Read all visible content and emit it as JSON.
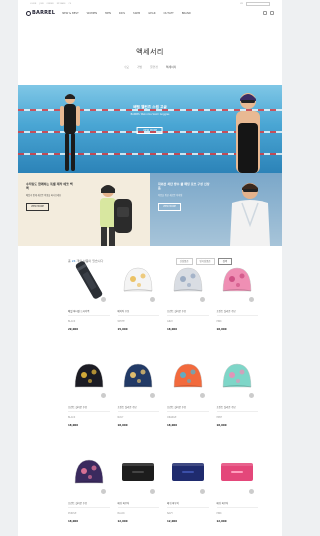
{
  "brand": {
    "logo_text": "BARREL"
  },
  "topbar": {
    "links": [
      "LOGIN",
      "JOIN",
      "ORDER",
      "MY PAGE",
      "CS"
    ],
    "right": "KR"
  },
  "gnb": [
    "NEW & BEST",
    "WOMEN",
    "MEN",
    "KIDS",
    "SWIM",
    "GEAR",
    "OUTLET",
    "BRAND"
  ],
  "page": {
    "title": "액세서리",
    "subnav": [
      "수모",
      "가방",
      "물안경",
      "액세서리"
    ]
  },
  "hero": {
    "title": "배럴 웰컨즈 스윔 고글",
    "subtitle": "BARREL Welcome Swim Goggles",
    "button": "VIEW MORE"
  },
  "banners": [
    {
      "title": "수저링도 함께하는 특별 제작 에코 백팩",
      "desc": "배럴과 함께 새로운 여행을 떠나보세요",
      "button": "VIEW MORE"
    },
    {
      "title": "자외선 차단 방수 쿨 패딩 로브 구성 신상품",
      "desc": "여름을 위한 새로운 아이템",
      "button": "VIEW MORE"
    }
  ],
  "listing": {
    "count_label": "총",
    "count_value": "24",
    "count_suffix": "개의 상품이 있습니다",
    "sort_options": [
      "신상품순",
      "인기상품순"
    ],
    "search_label": "검색"
  },
  "products": [
    {
      "name": "배럴 버티컬 드라이백",
      "sub": "BLACK",
      "price": "29,000",
      "icon": "dry-bag-icon"
    },
    {
      "name": "베이직 수모",
      "sub": "WHITE",
      "price": "15,000",
      "icon": "swim-cap-icon"
    },
    {
      "name": "프린트 실리콘 수모",
      "sub": "GRAY",
      "price": "18,000",
      "icon": "swim-cap-icon"
    },
    {
      "name": "프린트 실리콘 수모",
      "sub": "PINK",
      "price": "18,000",
      "icon": "swim-cap-icon"
    },
    {
      "name": "프린트 실리콘 수모",
      "sub": "BLACK",
      "price": "18,000",
      "icon": "swim-cap-icon"
    },
    {
      "name": "프린트 실리콘 수모",
      "sub": "NAVY",
      "price": "18,000",
      "icon": "swim-cap-icon"
    },
    {
      "name": "프린트 실리콘 수모",
      "sub": "ORANGE",
      "price": "18,000",
      "icon": "swim-cap-icon"
    },
    {
      "name": "프린트 실리콘 수모",
      "sub": "MINT",
      "price": "18,000",
      "icon": "swim-cap-icon"
    },
    {
      "name": "프린트 실리콘 수모",
      "sub": "PURPLE",
      "price": "18,000",
      "icon": "swim-cap-icon"
    },
    {
      "name": "메쉬 파우치",
      "sub": "BLACK",
      "price": "12,000",
      "icon": "pouch-icon"
    },
    {
      "name": "메쉬 파우치",
      "sub": "NAVY",
      "price": "12,000",
      "icon": "pouch-icon"
    },
    {
      "name": "메쉬 파우치",
      "sub": "PINK",
      "price": "12,000",
      "icon": "pouch-icon"
    }
  ],
  "colors": {
    "accent": "#2c7bc4",
    "pool": "#4aa6d4",
    "cap_white": "#f4f4f4",
    "cap_gray": "#d9dde3",
    "cap_pink": "#ef8fb4",
    "cap_black": "#1c1c24",
    "cap_navy": "#223a66",
    "cap_orange": "#f26a3d",
    "cap_mint": "#7ed6c8",
    "cap_purple": "#3a2a5e",
    "pouch_black": "#1d1d1d",
    "pouch_navy": "#1f2b6e",
    "pouch_pink": "#e4477a"
  }
}
